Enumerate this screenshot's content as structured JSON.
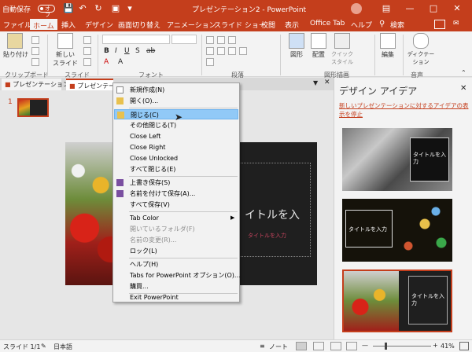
{
  "titlebar": {
    "autosave_label": "自動保存",
    "autosave_state": "オフ",
    "title": "プレゼンテーション2  -  PowerPoint",
    "colors": {
      "accent": "#c43e1c"
    }
  },
  "tabs": [
    "ファイル",
    "ホーム",
    "挿入",
    "デザイン",
    "画面切り替え",
    "アニメーション",
    "スライド ショー",
    "校閲",
    "表示",
    "Office Tab",
    "ヘルプ",
    "検索"
  ],
  "ribbon": {
    "paste": "貼り付け",
    "new_slide": "新しい\nスライド",
    "shapes": "図形",
    "arrange": "配置",
    "quick_styles": "クイック\nスタイル",
    "editing": "編集",
    "dictate": "ディクテー\nション",
    "groups": {
      "clipboard": "クリップボード",
      "slides": "スライド",
      "font": "フォント",
      "paragraph": "段落",
      "drawing": "図形描画",
      "voice": "音声"
    }
  },
  "doctabs": [
    "プレゼンテーション1",
    "プレゼンテー"
  ],
  "thumb_number": "1",
  "slide": {
    "title_placeholder": "イトルを入",
    "subtitle_placeholder": "タイトルを入力"
  },
  "menu": {
    "items": [
      {
        "label": "新規作成(N)"
      },
      {
        "label": "開く(O)..."
      },
      {
        "label": "閉じる(C)"
      },
      {
        "label": "その他閉じる(T)"
      },
      {
        "label": "Close Left"
      },
      {
        "label": "Close Right"
      },
      {
        "label": "Close Unlocked"
      },
      {
        "label": "すべて閉じる(E)"
      },
      {
        "label": "上書き保存(S)"
      },
      {
        "label": "名前を付けて保存(A)..."
      },
      {
        "label": "すべて保存(V)"
      },
      {
        "label": "Tab Color"
      },
      {
        "label": "開いているフォルダ(F)"
      },
      {
        "label": "名前の変更(R)..."
      },
      {
        "label": "ロック(L)"
      },
      {
        "label": "ヘルプ(H)"
      },
      {
        "label": "Tabs for PowerPoint オプション(O)..."
      },
      {
        "label": "購買..."
      },
      {
        "label": "Exit PowerPoint"
      }
    ]
  },
  "design": {
    "title": "デザイン アイデア",
    "link": "新しいプレゼンテーションに対するアイデアの表示を停止",
    "thumb1_text": "タイトルを入\n力",
    "thumb2_text": "タイトルを入力",
    "thumb3_text": "タイトルを入\n力"
  },
  "status": {
    "slide": "スライド 1/1",
    "lang": "日本語",
    "notes": "ノート",
    "zoom": "41%"
  }
}
